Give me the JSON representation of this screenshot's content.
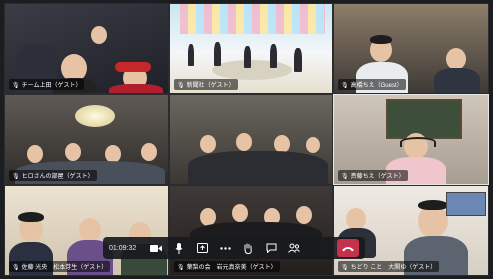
{
  "toolbar": {
    "timer": "01:09:32",
    "icons": [
      "camera-icon",
      "microphone-icon",
      "share-screen-icon",
      "more-icon",
      "raise-hand-icon",
      "chat-icon",
      "participants-icon",
      "leave-call-icon"
    ]
  },
  "tiles": [
    {
      "name": "チーム上田（ゲスト）"
    },
    {
      "name": "新聞社（ゲスト）"
    },
    {
      "name": "高橋ちえ（Guest）"
    },
    {
      "name": "ヒロさんの部屋（ゲスト）"
    },
    {
      "name": ""
    },
    {
      "name": "斉藤ちえ（ゲスト）"
    },
    {
      "name": "佐藤 光央　松本芽生（ゲスト）"
    },
    {
      "name": "葉梨の会　岩元真奈美（ゲスト）"
    },
    {
      "name": "ちどり こと　大関ゆ（ゲスト）"
    }
  ],
  "colors": {
    "active_outline": "#e6e6e6",
    "leave": "#c4314b"
  }
}
